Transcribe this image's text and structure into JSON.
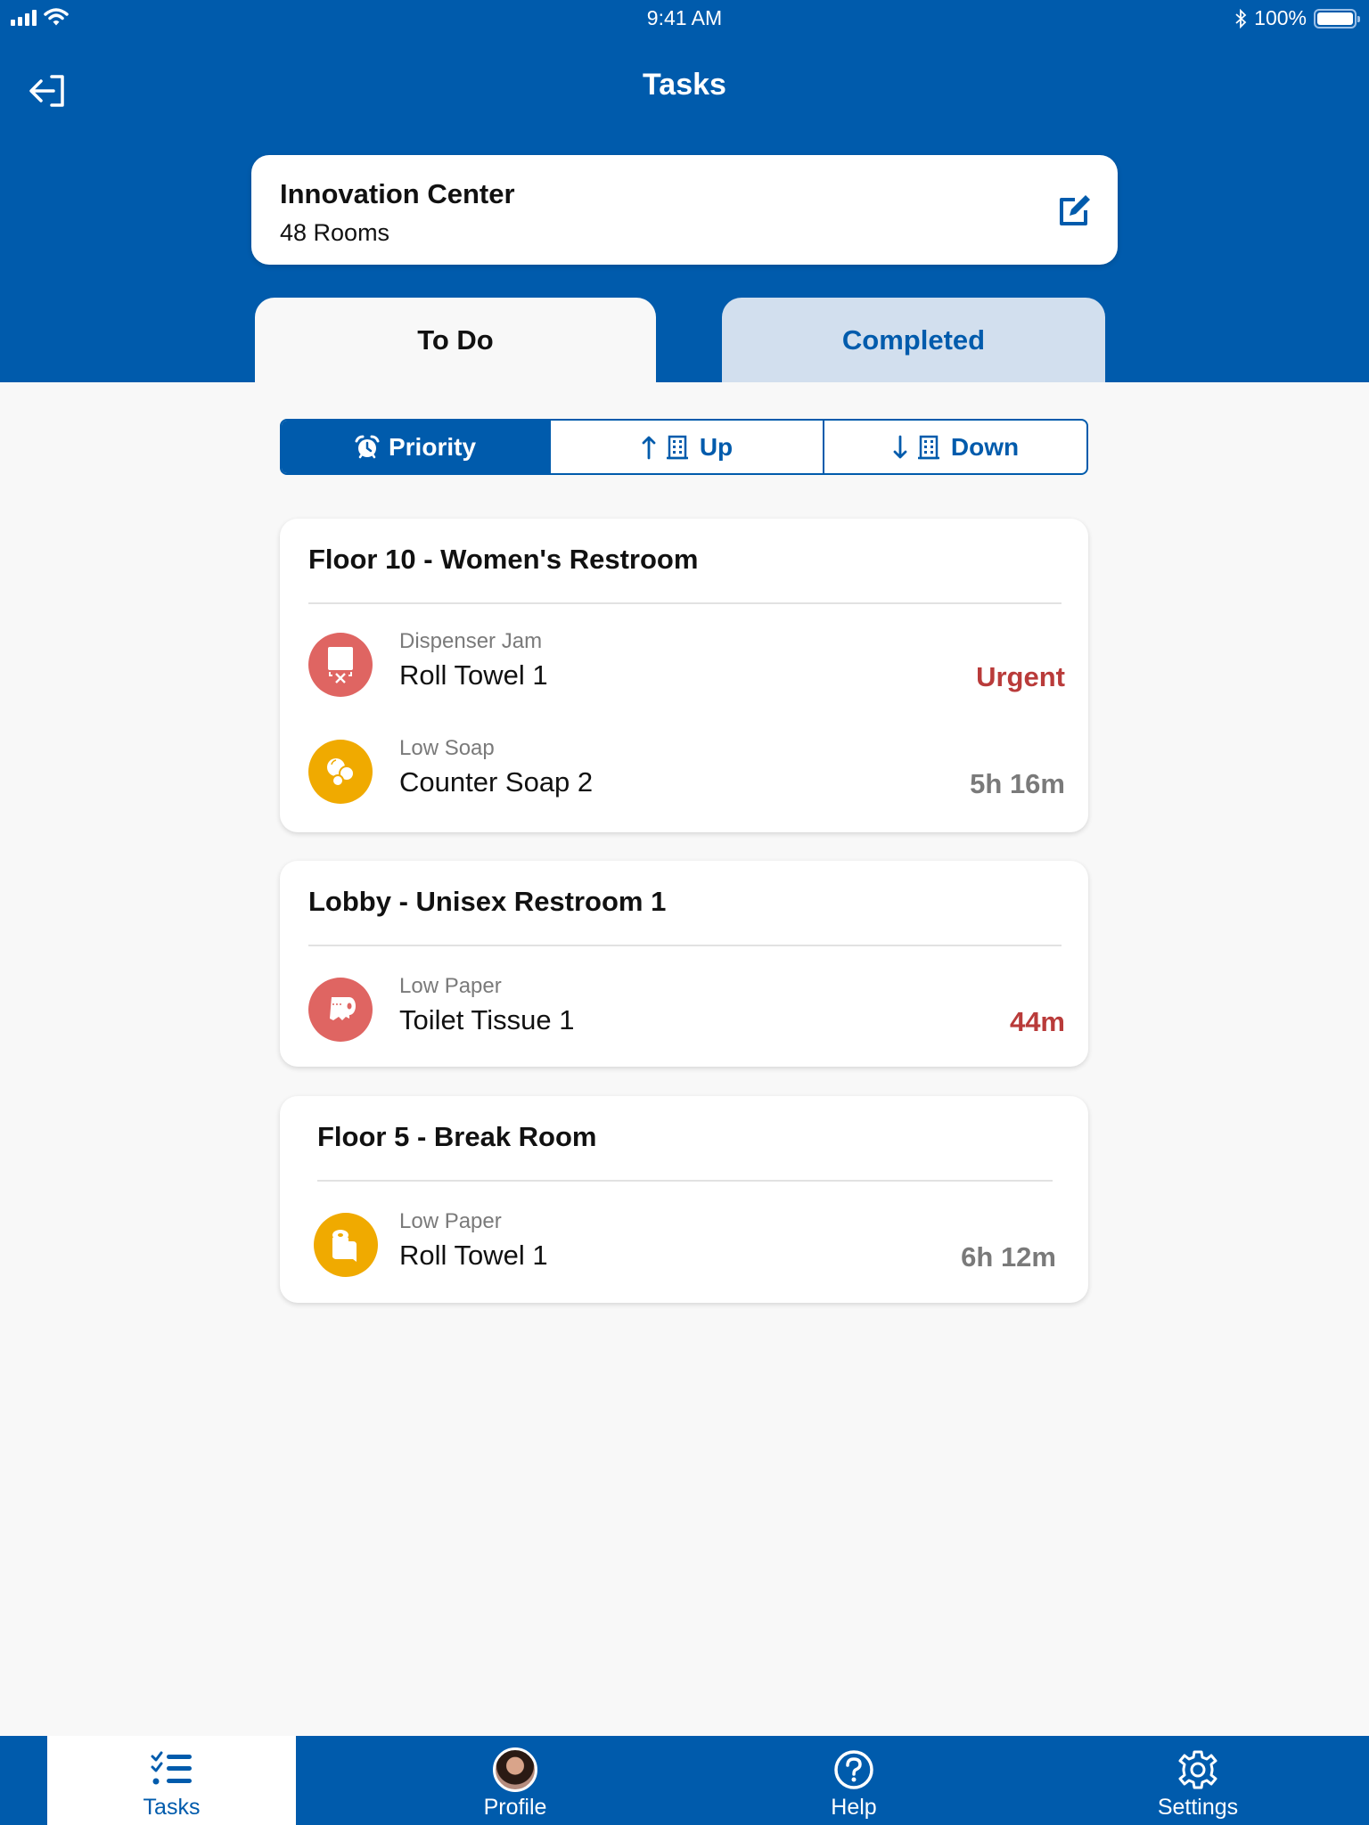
{
  "status_bar": {
    "time": "9:41 AM",
    "battery": "100%",
    "icons": [
      "signal-icon",
      "wifi-icon",
      "bluetooth-icon",
      "battery-icon"
    ]
  },
  "nav": {
    "title": "Tasks",
    "left_icon": "logout-icon"
  },
  "site": {
    "name": "Innovation Center",
    "rooms": "48 Rooms",
    "edit_icon": "edit-icon"
  },
  "tabs": [
    {
      "label": "To Do",
      "active": true
    },
    {
      "label": "Completed",
      "active": false
    }
  ],
  "sort": {
    "options": [
      {
        "label": "Priority",
        "icon": "alarm-clock-icon",
        "active": true
      },
      {
        "label": "Up",
        "icon": "arrow-up-building-icon",
        "active": false
      },
      {
        "label": "Down",
        "icon": "arrow-down-building-icon",
        "active": false
      }
    ]
  },
  "rooms": [
    {
      "title": "Floor 10 - Women's Restroom",
      "tasks": [
        {
          "issue": "Dispenser Jam",
          "item": "Roll Towel 1",
          "time": "Urgent",
          "status": "urgent",
          "icon": "towel-dispenser-jam-icon",
          "icon_color": "red"
        },
        {
          "issue": "Low Soap",
          "item": "Counter Soap 2",
          "time": "5h 16m",
          "status": "normal",
          "icon": "soap-bubbles-icon",
          "icon_color": "yellow"
        }
      ]
    },
    {
      "title": "Lobby - Unisex Restroom 1",
      "tasks": [
        {
          "issue": "Low Paper",
          "item": "Toilet Tissue 1",
          "time": "44m",
          "status": "urgent",
          "icon": "toilet-paper-icon",
          "icon_color": "red"
        }
      ]
    },
    {
      "title": "Floor 5 - Break Room",
      "tasks": [
        {
          "issue": "Low Paper",
          "item": "Roll Towel 1",
          "time": "6h 12m",
          "status": "normal",
          "icon": "paper-roll-icon",
          "icon_color": "yellow"
        }
      ]
    }
  ],
  "tabbar": [
    {
      "label": "Tasks",
      "icon": "task-list-icon",
      "active": true
    },
    {
      "label": "Profile",
      "icon": "avatar",
      "active": false
    },
    {
      "label": "Help",
      "icon": "help-icon",
      "active": false
    },
    {
      "label": "Settings",
      "icon": "gear-icon",
      "active": false
    }
  ],
  "colors": {
    "brand": "#005BAC",
    "urgent": "#B93B3A",
    "muted": "#7A7A7A",
    "icon_red": "#DF6562",
    "icon_yellow": "#F0AA00",
    "tab_inactive": "#D2DFEE"
  }
}
